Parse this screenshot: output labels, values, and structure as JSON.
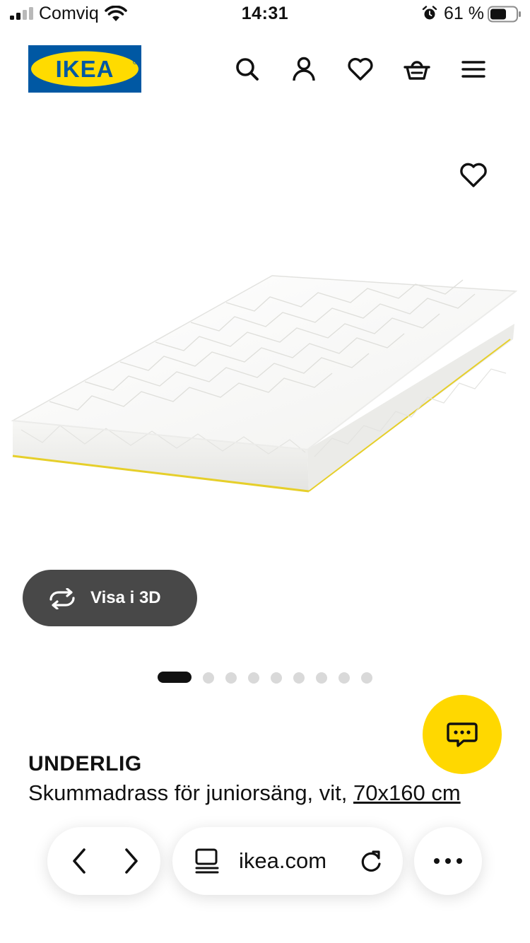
{
  "status_bar": {
    "carrier": "Comviq",
    "time": "14:31",
    "battery": "61 %"
  },
  "header": {
    "logo_text": "IKEA",
    "icons": [
      "search-icon",
      "account-icon",
      "heart-icon",
      "basket-icon",
      "menu-icon"
    ]
  },
  "gallery": {
    "view_3d_label": "Visa i 3D",
    "image_count": 9,
    "active_index": 0
  },
  "product": {
    "name": "UNDERLIG",
    "description": "Skummadrass för juniorsäng, vit, ",
    "size": "70x160 cm"
  },
  "browser": {
    "url": "ikea.com"
  },
  "colors": {
    "brand_blue": "#0058A3",
    "brand_yellow": "#FFDB00",
    "button_dark": "#484848",
    "chat_yellow": "#FFD800"
  }
}
